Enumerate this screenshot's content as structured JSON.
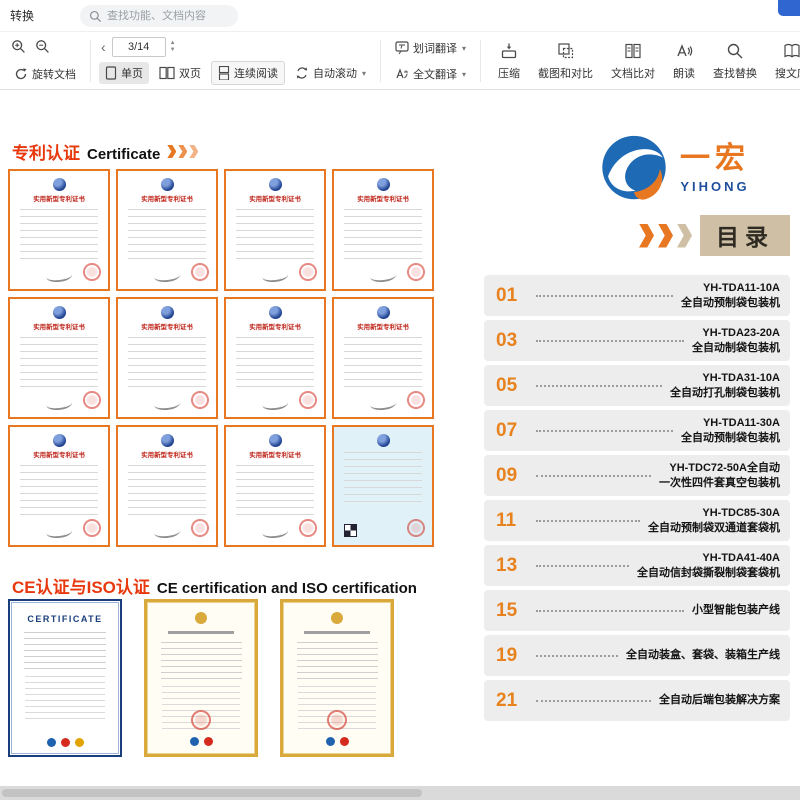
{
  "toolbar": {
    "convert_label": "转换",
    "search_placeholder": "查找功能、文档内容",
    "rotate": "旋转文档",
    "page_indicator": "3/14",
    "view_single": "单页",
    "view_double": "双页",
    "view_continuous": "连续阅读",
    "auto_scroll": "自动滚动",
    "word_translate": "划词翻译",
    "full_translate": "全文翻译",
    "compress": "压缩",
    "screenshot_compare": "截图和对比",
    "doc_compare": "文档比对",
    "read_aloud": "朗读",
    "find_replace": "查找替换",
    "search_library": "搜文库"
  },
  "page": {
    "patent_heading_zh": "专利认证",
    "patent_heading_en": "Certificate",
    "patent_cert_title": "实用新型专利证书",
    "ce_heading_zh": "CE认证与ISO认证",
    "ce_heading_en": "CE certification and ISO certification",
    "ce_cert_title": "CERTIFICATE",
    "logo_zh": "一宏",
    "logo_en": "YIHONG",
    "toc_title": "目录",
    "toc": [
      {
        "num": "01",
        "line1": "YH-TDA11-10A",
        "line2": "全自动预制袋包装机"
      },
      {
        "num": "03",
        "line1": "YH-TDA23-20A",
        "line2": "全自动制袋包装机"
      },
      {
        "num": "05",
        "line1": "YH-TDA31-10A",
        "line2": "全自动打孔制袋包装机"
      },
      {
        "num": "07",
        "line1": "YH-TDA11-30A",
        "line2": "全自动预制袋包装机"
      },
      {
        "num": "09",
        "line1": "YH-TDC72-50A全自动",
        "line2": "一次性四件套真空包装机"
      },
      {
        "num": "11",
        "line1": "YH-TDC85-30A",
        "line2": "全自动预制袋双通道套袋机"
      },
      {
        "num": "13",
        "line1": "YH-TDA41-40A",
        "line2": "全自动信封袋撕裂制袋套袋机"
      },
      {
        "num": "15",
        "line1": "",
        "line2": "小型智能包装产线"
      },
      {
        "num": "19",
        "line1": "",
        "line2": "全自动装盒、套袋、装箱生产线"
      },
      {
        "num": "21",
        "line1": "",
        "line2": "全自动后端包装解决方案"
      }
    ]
  }
}
